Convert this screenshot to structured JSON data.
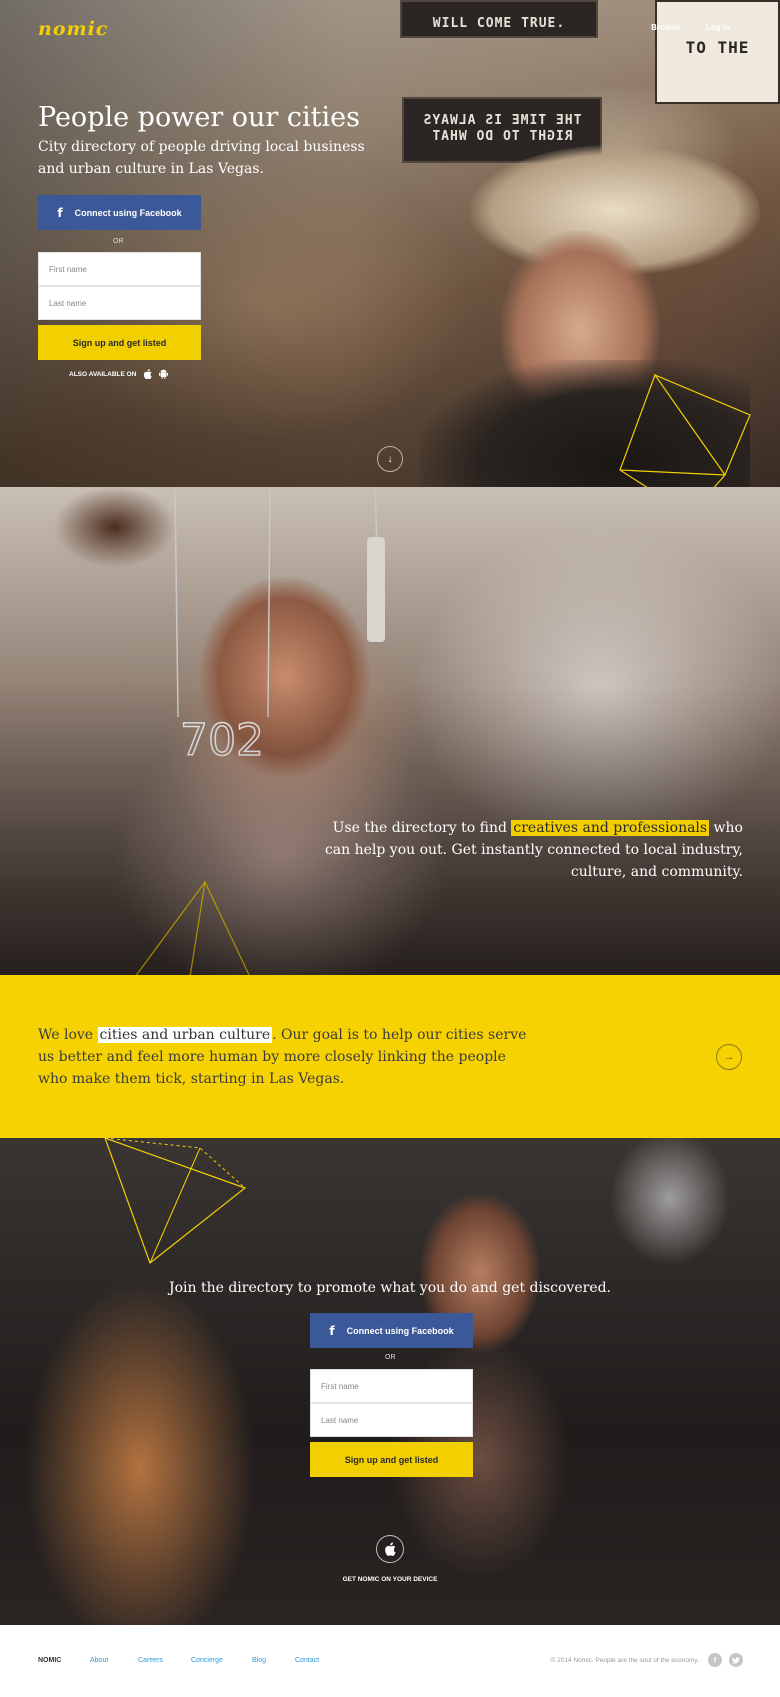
{
  "brand": {
    "logo": "nomic"
  },
  "topnav": {
    "browse": "Browse",
    "login": "Log in"
  },
  "hero": {
    "title": "People power our cities",
    "subtitle": "City directory of people driving local business and urban culture in Las Vegas.",
    "facebook_label": "Connect using Facebook",
    "or_label": "OR",
    "first_name_placeholder": "First name",
    "last_name_placeholder": "Last name",
    "signup_label": "Sign up and get listed",
    "also_available": "ALSO AVAILABLE ON",
    "signs": [
      "WILL COME TRUE.",
      "THE TIME IS ALWAYS",
      "RIGHT TO DO WHAT",
      "TO THE"
    ]
  },
  "section2": {
    "text_before": "Use the directory to find ",
    "highlight": "creatives and professionals",
    "text_after": " who can help you out. Get instantly connected to local industry, culture, and community.",
    "necklace_number": "702"
  },
  "yellow": {
    "text_before": "We love ",
    "highlight": "cities and urban culture",
    "text_after": ". Our goal is to help our cities serve us better and feel more human by more closely linking the people who make them tick, starting in Las Vegas."
  },
  "section4": {
    "heading": "Join the directory to promote what you do and get discovered.",
    "facebook_label": "Connect using Facebook",
    "or_label": "OR",
    "first_name_placeholder": "First name",
    "last_name_placeholder": "Last name",
    "signup_label": "Sign up and get listed",
    "get_app": "GET NOMIC ON YOUR DEVICE"
  },
  "footer": {
    "brand": "NOMIC",
    "links": [
      "About",
      "Careers",
      "Concierge",
      "Blog",
      "Contact"
    ],
    "copyright": "© 2014 Nomic. People are the soul of the economy."
  },
  "colors": {
    "accent_yellow": "#f7d203",
    "facebook_blue": "#3b5998",
    "link_blue": "#2e9bd6"
  }
}
